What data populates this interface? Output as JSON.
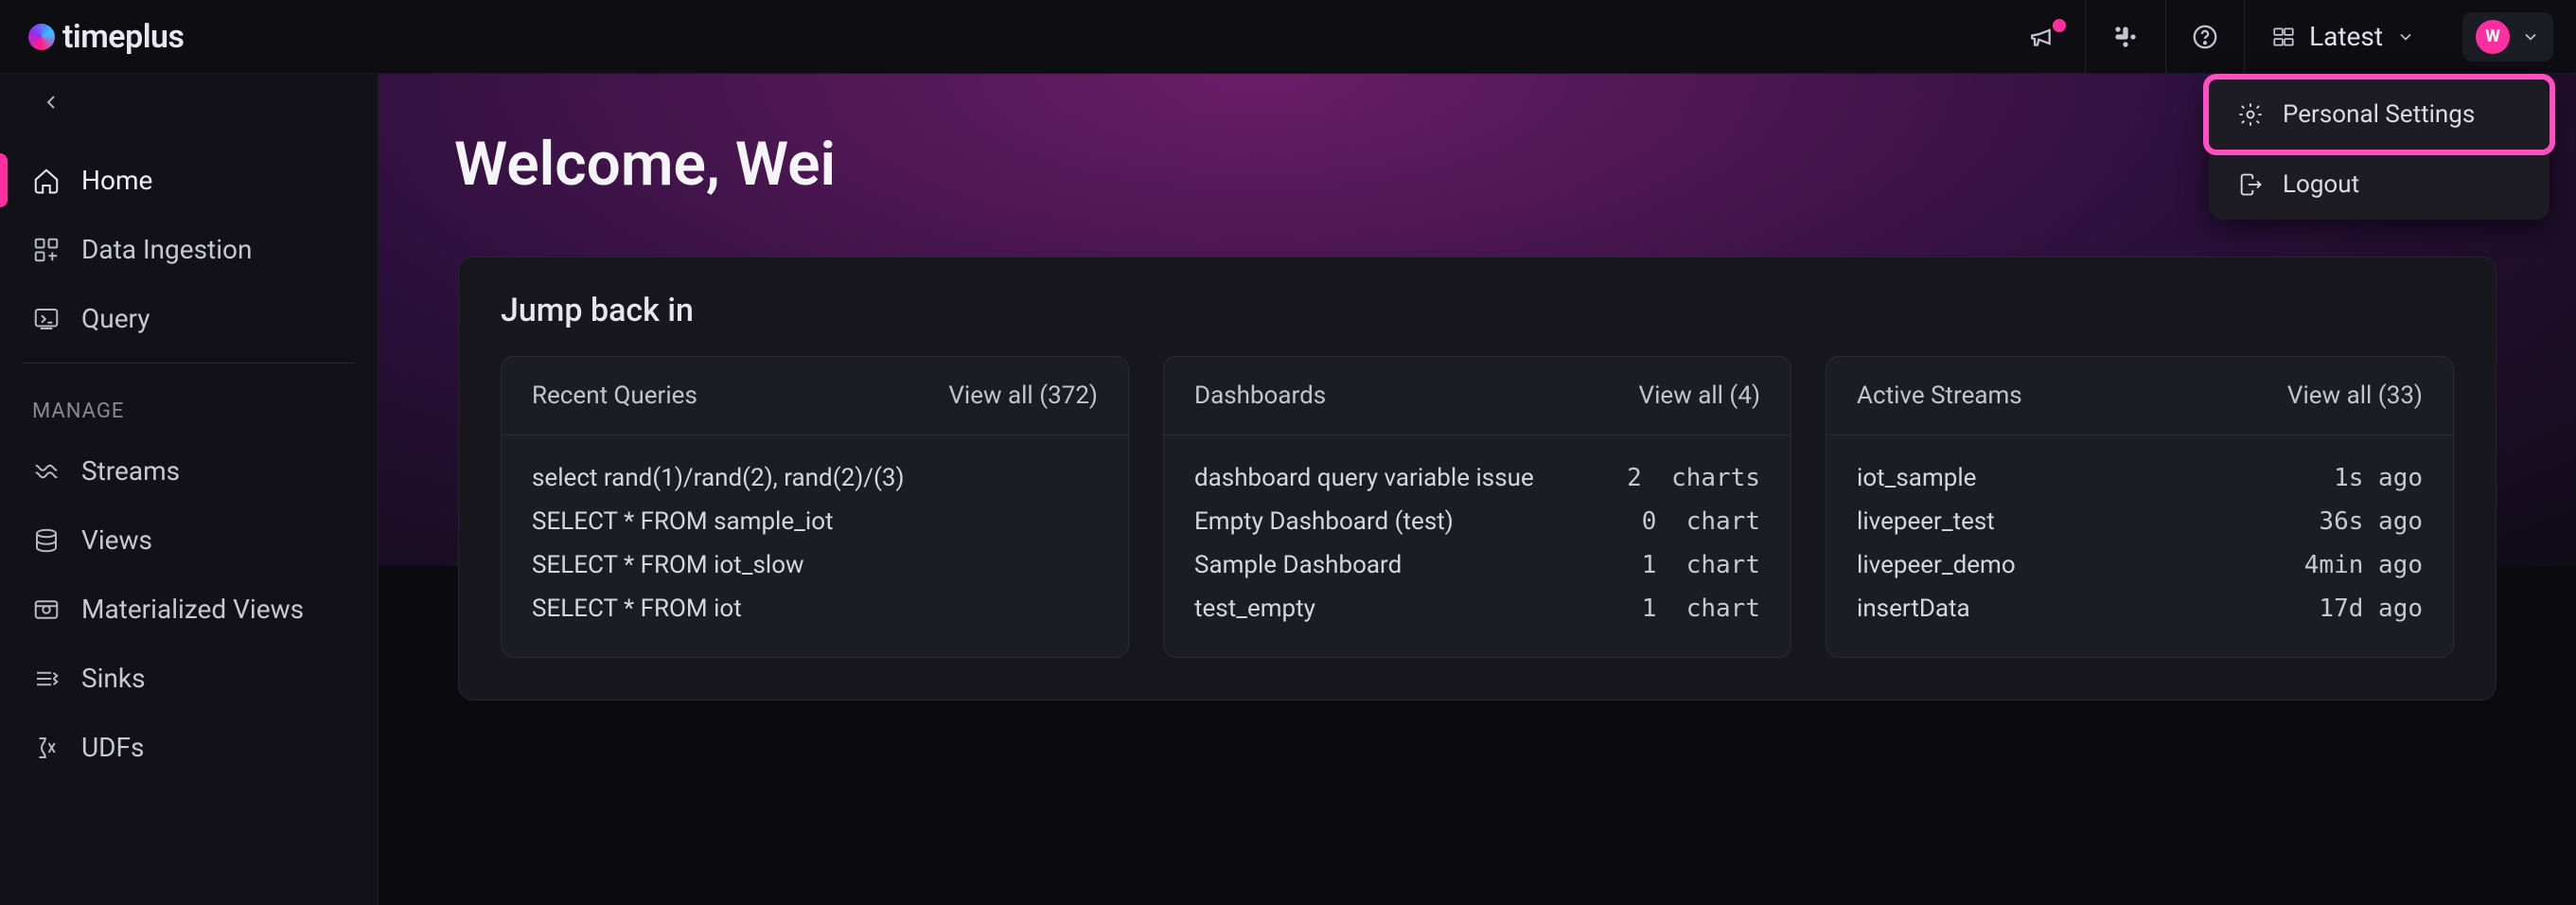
{
  "brand": {
    "name": "timeplus"
  },
  "topbar": {
    "workspace_label": "Latest",
    "avatar_initial": "W"
  },
  "user_menu": {
    "personal_settings": "Personal Settings",
    "logout": "Logout"
  },
  "sidebar": {
    "items": [
      {
        "label": "Home"
      },
      {
        "label": "Data Ingestion"
      },
      {
        "label": "Query"
      }
    ],
    "manage_label": "MANAGE",
    "manage_items": [
      {
        "label": "Streams"
      },
      {
        "label": "Views"
      },
      {
        "label": "Materialized Views"
      },
      {
        "label": "Sinks"
      },
      {
        "label": "UDFs"
      }
    ]
  },
  "hero": {
    "title": "Welcome, Wei"
  },
  "jump": {
    "title": "Jump back in",
    "recent": {
      "title": "Recent Queries",
      "view_all": "View all (372)",
      "rows": [
        "select rand(1)/rand(2), rand(2)/(3)",
        "SELECT * FROM sample_iot",
        "SELECT * FROM iot_slow",
        "SELECT * FROM iot"
      ]
    },
    "dashboards": {
      "title": "Dashboards",
      "view_all": "View all (4)",
      "rows": [
        {
          "name": "dashboard query variable issue",
          "meta": "2  charts"
        },
        {
          "name": "Empty Dashboard (test)",
          "meta": "0  chart"
        },
        {
          "name": "Sample Dashboard",
          "meta": "1  chart"
        },
        {
          "name": "test_empty",
          "meta": "1  chart"
        }
      ]
    },
    "streams": {
      "title": "Active Streams",
      "view_all": "View all (33)",
      "rows": [
        {
          "name": "iot_sample",
          "meta": "1s ago"
        },
        {
          "name": "livepeer_test",
          "meta": "36s ago"
        },
        {
          "name": "livepeer_demo",
          "meta": "4min ago"
        },
        {
          "name": "insertData",
          "meta": "17d ago"
        }
      ]
    }
  }
}
